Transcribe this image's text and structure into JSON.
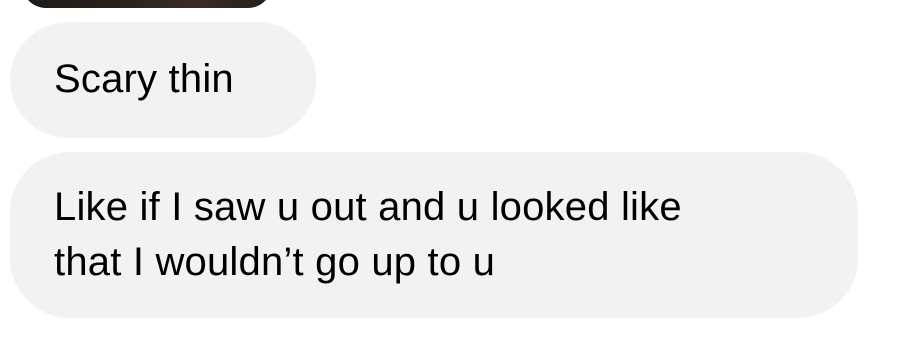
{
  "messages": [
    {
      "lines": [
        "Scary thin"
      ]
    },
    {
      "lines": [
        "Like if I saw u out and u looked like",
        "that I wouldn’t go up to u"
      ]
    }
  ],
  "colors": {
    "bubble_bg": "#f2f2f2",
    "text": "#000000",
    "background": "#ffffff"
  }
}
